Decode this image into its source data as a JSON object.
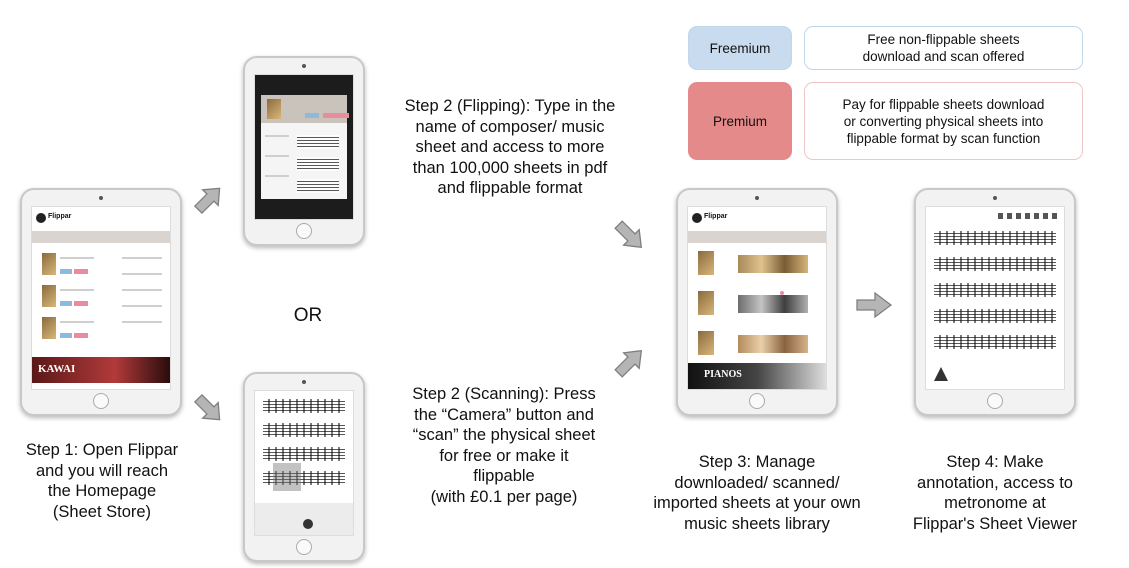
{
  "legend": {
    "freemium": {
      "label": "Freemium",
      "description_lines": [
        "Free non-flippable sheets",
        "download and scan offered"
      ],
      "color": "#c9dcef",
      "border_color": "#c3d6ea"
    },
    "premium": {
      "label": "Premium",
      "description_lines": [
        "Pay for flippable sheets download",
        "or converting physical sheets into",
        "flippable format by scan function"
      ],
      "color": "#e58a8a",
      "border_color": "#efc6c6"
    }
  },
  "steps": {
    "step1": {
      "lines": [
        "Step 1: Open Flippar",
        "and you will reach",
        "the Homepage",
        "(Sheet Store)"
      ]
    },
    "step2_flipping": {
      "lines": [
        "Step 2 (Flipping): Type in the",
        "name of composer/ music",
        "sheet and access to more",
        "than 100,000 sheets in pdf",
        "and flippable format"
      ]
    },
    "or_label": "OR",
    "step2_scanning": {
      "lines": [
        "Step 2 (Scanning): Press",
        "the “Camera” button and",
        "“scan” the physical sheet",
        "for free or make it",
        "flippable",
        "(with £0.1 per page)"
      ]
    },
    "step3": {
      "lines": [
        "Step 3: Manage",
        "downloaded/ scanned/",
        "imported sheets at your own",
        "music sheets library"
      ]
    },
    "step4": {
      "lines": [
        "Step 4: Make",
        "annotation, access to",
        "metronome at",
        "Flippar's Sheet Viewer"
      ]
    }
  },
  "screens": {
    "home": {
      "app_name": "Flippar",
      "banner_text": "KAWAI"
    },
    "library": {
      "app_name": "Flippar",
      "banner_text": "PIANOS"
    }
  },
  "icons": [
    "arrow-right-icon",
    "arrow-diagonal-up-icon",
    "arrow-diagonal-down-icon"
  ],
  "colors": {
    "arrow_fill": "#b5b5b5",
    "arrow_stroke": "#7f7f7f"
  }
}
